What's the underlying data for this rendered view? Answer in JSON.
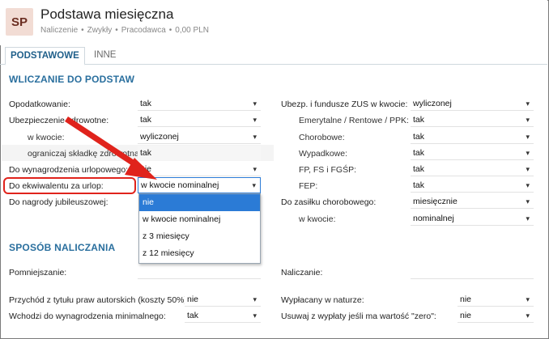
{
  "header": {
    "avatar_initials": "SP",
    "title": "Podstawa miesięczna",
    "breadcrumb": [
      "Naliczenie",
      "Zwykły",
      "Pracodawca",
      "0,00 PLN"
    ]
  },
  "tabs": [
    {
      "label": "PODSTAWOWE",
      "active": true
    },
    {
      "label": "INNE",
      "active": false
    }
  ],
  "section1": {
    "title": "WLICZANIE DO PODSTAW",
    "left": [
      {
        "label": "Opodatkowanie:",
        "value": "tak"
      },
      {
        "label": "Ubezpieczenie zdrowotne:",
        "value": "tak"
      },
      {
        "label": "w kwocie:",
        "value": "wyliczonej"
      },
      {
        "label": "ograniczaj składkę zdrowotną:",
        "value": "tak"
      },
      {
        "label": "Do wynagrodzenia urlopowego:",
        "value": "nie"
      },
      {
        "label": "Do ekwiwalentu za urlop:",
        "value": "w kwocie nominalnej"
      },
      {
        "label": "Do nagrody jubileuszowej:",
        "value": ""
      }
    ],
    "right": [
      {
        "label": "Ubezp. i fundusze ZUS w kwocie:",
        "value": "wyliczonej"
      },
      {
        "label": "Emerytalne / Rentowe / PPK:",
        "value": "tak"
      },
      {
        "label": "Chorobowe:",
        "value": "tak"
      },
      {
        "label": "Wypadkowe:",
        "value": "tak"
      },
      {
        "label": "FP, FS i FGŚP:",
        "value": "tak"
      },
      {
        "label": "FEP:",
        "value": "tak"
      },
      {
        "label": "Do zasiłku chorobowego:",
        "value": "miesięcznie"
      },
      {
        "label": "w kwocie:",
        "value": "nominalnej"
      }
    ]
  },
  "dropdown_options": [
    "nie",
    "w kwocie nominalnej",
    "z 3 miesięcy",
    "z 12 miesięcy"
  ],
  "section2": {
    "title": "SPOSÓB NALICZANIA",
    "pomniejszanie_label": "Pomniejszanie:",
    "naliczanie_label": "Naliczanie:",
    "left": [
      {
        "label": "Przychód z tytułu praw autorskich (koszty 50%):",
        "value": "nie"
      },
      {
        "label": "Wchodzi do wynagrodzenia minimalnego:",
        "value": "tak"
      }
    ],
    "right": [
      {
        "label": "Wypłacany w naturze:",
        "value": "nie"
      },
      {
        "label": "Usuwaj z wypłaty jeśli ma wartość \"zero\":",
        "value": "nie"
      }
    ]
  },
  "colors": {
    "accent": "#2a6f9e",
    "focus": "#2b7bd6",
    "highlight": "#e0231c"
  }
}
